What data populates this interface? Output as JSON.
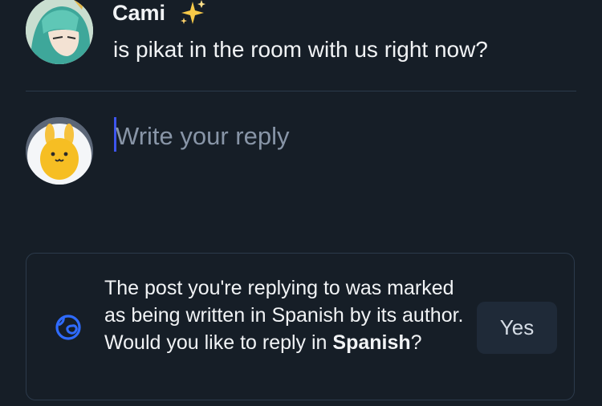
{
  "quoted_post": {
    "author": "Cami",
    "author_emoji": "sparkles-icon",
    "text": "is pikat in the room with us right now?"
  },
  "composer": {
    "placeholder": "Write your reply"
  },
  "language_prompt": {
    "icon": "globe-icon",
    "message_before": "The post you're replying to was marked as being written in Spanish by its author. Would you like to reply in ",
    "language": "Spanish",
    "message_after": "?",
    "yes_label": "Yes"
  },
  "colors": {
    "background": "#161e27",
    "accent": "#3d55ee",
    "globe": "#2f6bff",
    "button_bg": "#1f2a38",
    "divider": "#2c3a4b"
  }
}
